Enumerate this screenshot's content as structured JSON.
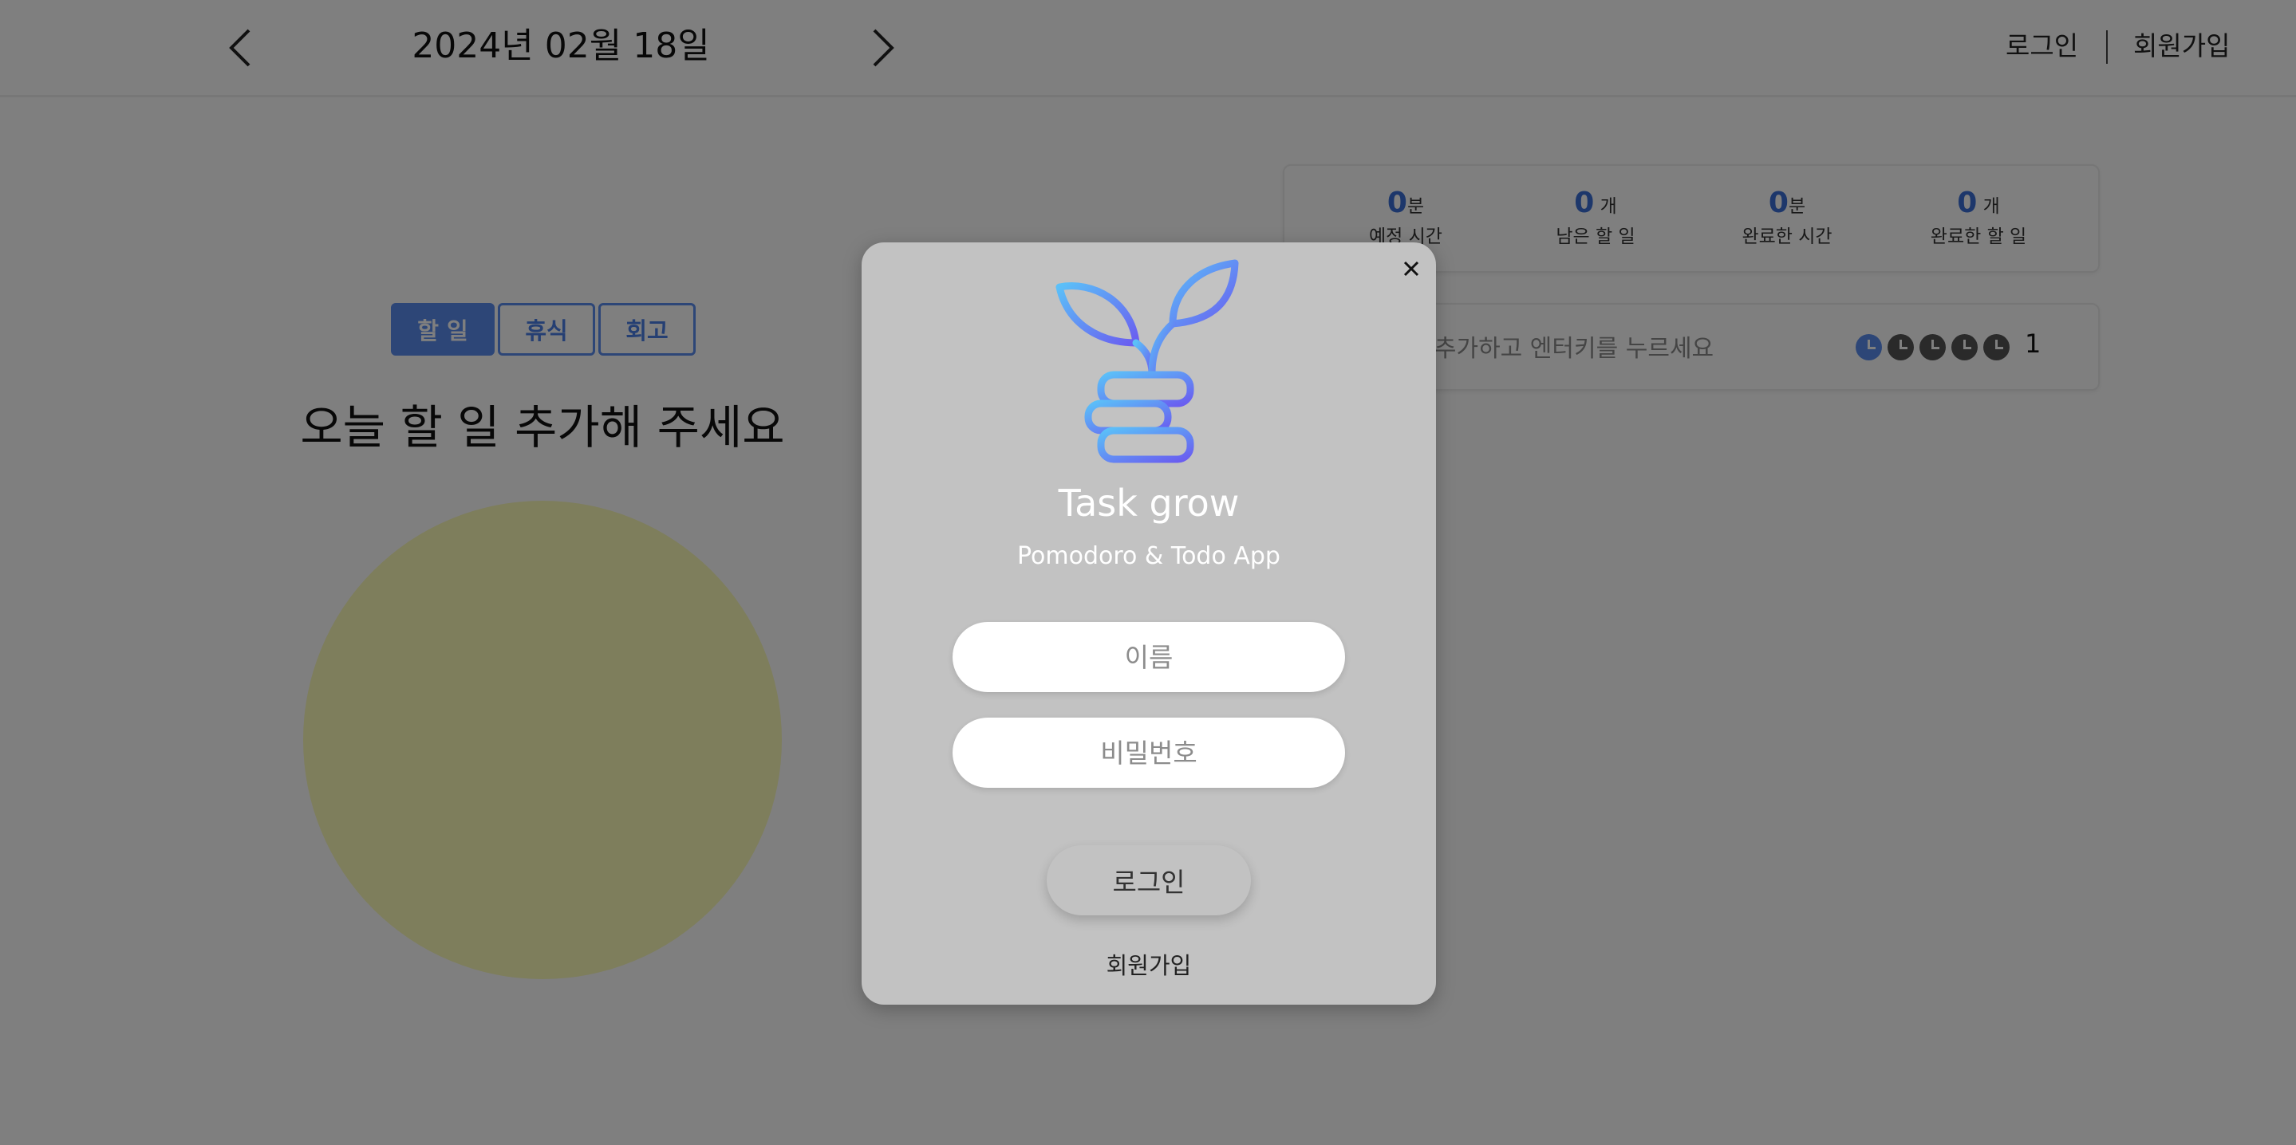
{
  "header": {
    "date": "2024년 02월 18일",
    "login_label": "로그인",
    "signup_label": "회원가입"
  },
  "tabs": [
    {
      "label": "할 일",
      "active": true
    },
    {
      "label": "휴식",
      "active": false
    },
    {
      "label": "회고",
      "active": false
    }
  ],
  "main": {
    "heading": "오늘 할 일 추가해 주세요",
    "timer_color": "#fdfcb8"
  },
  "stats": [
    {
      "value": "0",
      "unit": "분",
      "label": "예정 시간"
    },
    {
      "value": "0",
      "unit": " 개",
      "label": "남은 할 일"
    },
    {
      "value": "0",
      "unit": "분",
      "label": "완료한 시간"
    },
    {
      "value": "0",
      "unit": " 개",
      "label": "완료한 할 일"
    }
  ],
  "todo_input": {
    "placeholder": "할 일을 추가하고 엔터키를 누르세요",
    "pomodoro_count": "1",
    "pomodoro_icons": 5,
    "active_pomodoro": 1
  },
  "modal": {
    "title": "Task grow",
    "subtitle": "Pomodoro & Todo App",
    "name_placeholder": "이름",
    "password_placeholder": "비밀번호",
    "login_button": "로그인",
    "signup_link": "회원가입",
    "logo_icon": "sprout-on-coins-icon",
    "logo_gradient": [
      "#5bc0f8",
      "#6a5cf0"
    ]
  },
  "colors": {
    "accent": "#5b8def",
    "overlay": "rgba(0,0,0,0.5)",
    "modal_bg": "#c2c2c2"
  }
}
